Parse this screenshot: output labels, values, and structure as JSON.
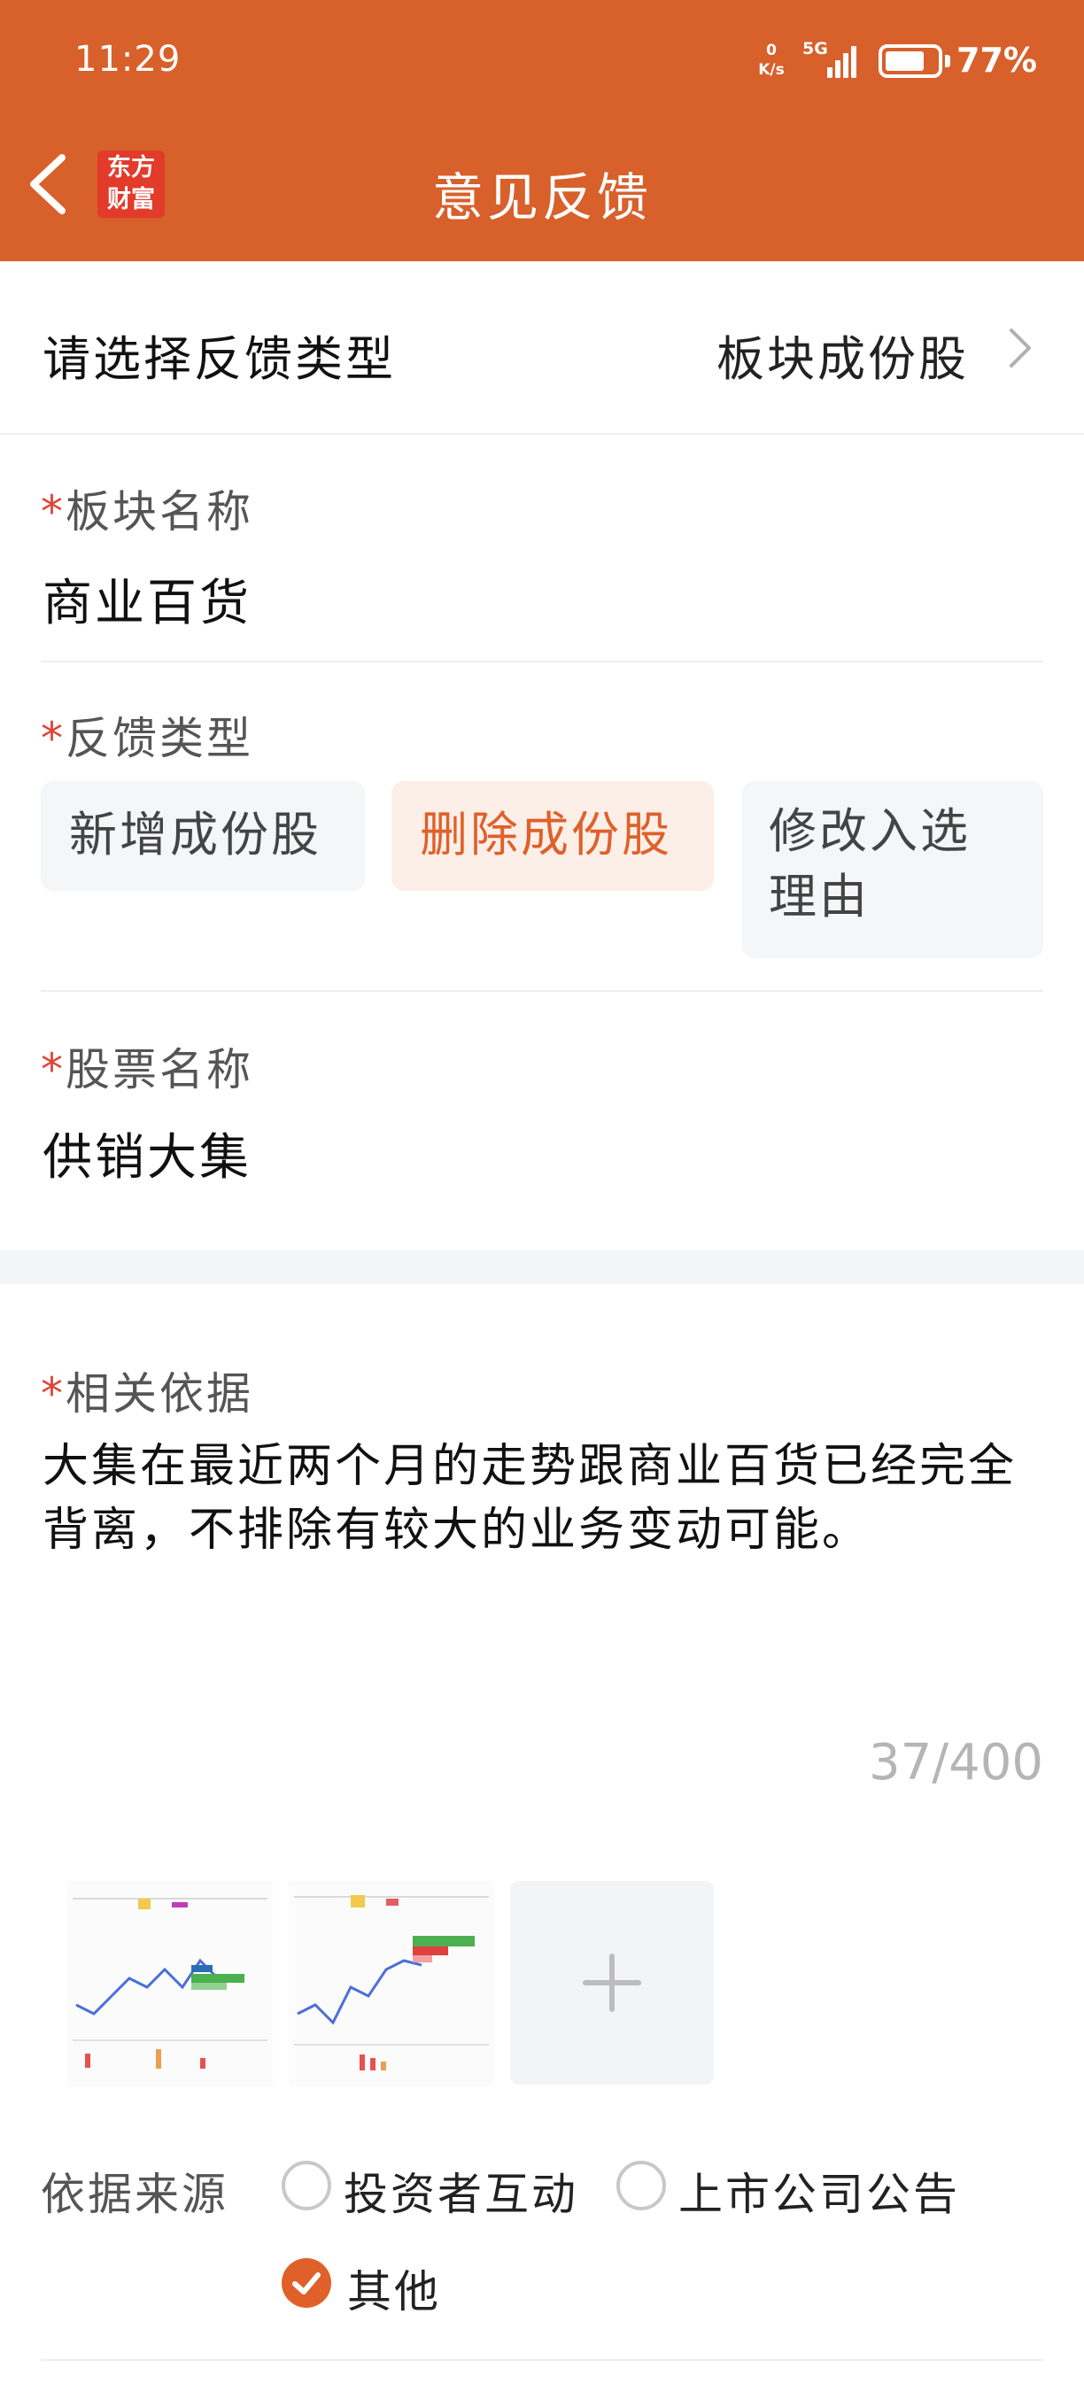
{
  "status_bar": {
    "time": "11:29",
    "net_speed_value": "0",
    "net_speed_unit": "K/s",
    "network": "5G",
    "battery_percent_label": "77%",
    "battery_level": 0.77
  },
  "nav": {
    "back_icon": "chevron-left-icon",
    "logo_line1": "东方",
    "logo_line2": "财富",
    "title": "意见反馈"
  },
  "feedback_type": {
    "label": "请选择反馈类型",
    "value": "板块成份股"
  },
  "sector": {
    "required_mark": "*",
    "label": "板块名称",
    "value": "商业百货"
  },
  "feedback_kind": {
    "required_mark": "*",
    "label": "反馈类型",
    "options": [
      "新增成份股",
      "删除成份股",
      "修改入选理由"
    ],
    "selected": "删除成份股"
  },
  "stock": {
    "required_mark": "*",
    "label": "股票名称",
    "value": "供销大集"
  },
  "basis": {
    "required_mark": "*",
    "label": "相关依据",
    "text": "大集在最近两个月的走势跟商业百货已经完全背离，不排除有较大的业务变动可能。",
    "count": "37/400"
  },
  "attachments": {
    "thumbnails": [
      "chart-screenshot-1",
      "chart-screenshot-2"
    ],
    "add_icon": "plus-icon"
  },
  "source": {
    "label": "依据来源",
    "options": [
      "投资者互动",
      "上市公司公告",
      "其他"
    ],
    "selected": "其他"
  },
  "colors": {
    "brand": "#d8602b",
    "accent": "#e0602a",
    "required": "#e04437"
  }
}
